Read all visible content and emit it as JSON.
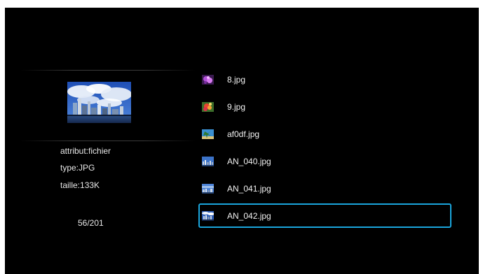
{
  "info": {
    "attribute": "attribut:fichier",
    "type": "type:JPG",
    "size": "taille:133K",
    "counter": "56/201"
  },
  "files": [
    {
      "name": "8.jpg",
      "thumb_icon": "purple-flower-thumbnail",
      "selected": false
    },
    {
      "name": "9.jpg",
      "thumb_icon": "red-flower-thumbnail",
      "selected": false
    },
    {
      "name": "af0df.jpg",
      "thumb_icon": "palm-tree-thumbnail",
      "selected": false
    },
    {
      "name": "AN_040.jpg",
      "thumb_icon": "city-skyline-thumbnail",
      "selected": false
    },
    {
      "name": "AN_041.jpg",
      "thumb_icon": "city-skyline-thumbnail",
      "selected": false
    },
    {
      "name": "AN_042.jpg",
      "thumb_icon": "city-skyline-thumbnail",
      "selected": true
    }
  ],
  "colors": {
    "background": "#000000",
    "selection_border": "#1aa5dc",
    "text": "#f0f0f0"
  }
}
